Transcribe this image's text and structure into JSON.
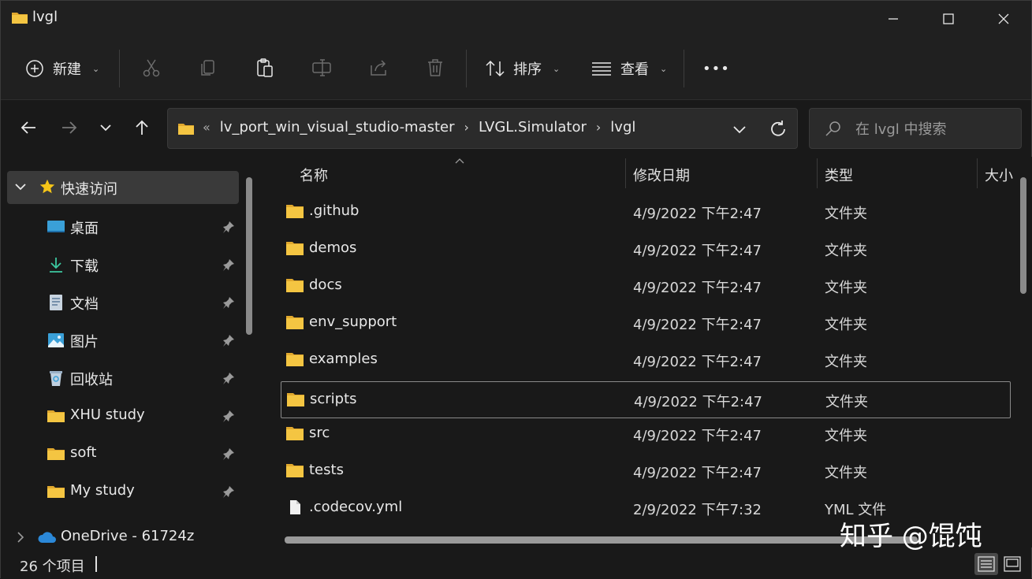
{
  "window": {
    "title": "lvgl",
    "controls": {
      "minimize": "—",
      "maximize": "☐",
      "close": "✕"
    }
  },
  "toolbar": {
    "new_label": "新建",
    "sort_label": "排序",
    "view_label": "查看",
    "more_label": "•••",
    "icons": [
      "cut-icon",
      "copy-icon",
      "paste-icon",
      "rename-icon",
      "share-icon",
      "delete-icon"
    ]
  },
  "address": {
    "overflow": "«",
    "crumbs": [
      "lv_port_win_visual_studio-master",
      "LVGL.Simulator",
      "lvgl"
    ],
    "separator": "›"
  },
  "search": {
    "placeholder": "在 lvgl 中搜索"
  },
  "sidebar": {
    "quick_access": "快速访问",
    "items": [
      {
        "label": "桌面",
        "icon": "desktop-icon"
      },
      {
        "label": "下载",
        "icon": "download-icon"
      },
      {
        "label": "文档",
        "icon": "document-icon"
      },
      {
        "label": "图片",
        "icon": "picture-icon"
      },
      {
        "label": "回收站",
        "icon": "recycle-bin-icon"
      },
      {
        "label": "XHU study",
        "icon": "folder-icon"
      },
      {
        "label": "soft",
        "icon": "folder-icon"
      },
      {
        "label": "My study",
        "icon": "folder-icon"
      }
    ],
    "onedrive": "OneDrive - 61724z"
  },
  "columns": {
    "name": "名称",
    "modified": "修改日期",
    "type": "类型",
    "size": "大小"
  },
  "files": [
    {
      "name": ".github",
      "modified": "4/9/2022 下午2:47",
      "type": "文件夹",
      "kind": "folder"
    },
    {
      "name": "demos",
      "modified": "4/9/2022 下午2:47",
      "type": "文件夹",
      "kind": "folder"
    },
    {
      "name": "docs",
      "modified": "4/9/2022 下午2:47",
      "type": "文件夹",
      "kind": "folder"
    },
    {
      "name": "env_support",
      "modified": "4/9/2022 下午2:47",
      "type": "文件夹",
      "kind": "folder"
    },
    {
      "name": "examples",
      "modified": "4/9/2022 下午2:47",
      "type": "文件夹",
      "kind": "folder"
    },
    {
      "name": "scripts",
      "modified": "4/9/2022 下午2:47",
      "type": "文件夹",
      "kind": "folder",
      "selected": true
    },
    {
      "name": "src",
      "modified": "4/9/2022 下午2:47",
      "type": "文件夹",
      "kind": "folder"
    },
    {
      "name": "tests",
      "modified": "4/9/2022 下午2:47",
      "type": "文件夹",
      "kind": "folder"
    },
    {
      "name": ".codecov.yml",
      "modified": "2/9/2022 下午7:32",
      "type": "YML 文件",
      "kind": "file"
    }
  ],
  "status": {
    "count": "26 个项目"
  },
  "watermark": "知乎 @馄饨",
  "colors": {
    "folder": "#f4c542",
    "folder_dark": "#e0a82e",
    "accent_blue": "#4fa3e0",
    "star": "#f5c518"
  }
}
